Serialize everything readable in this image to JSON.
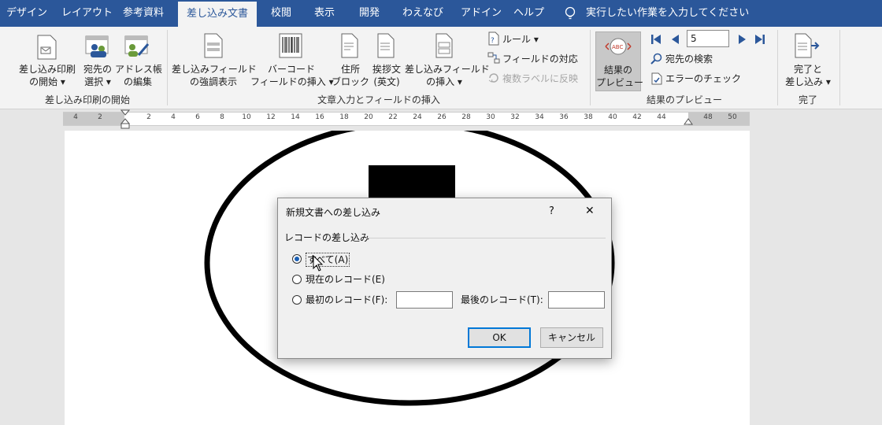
{
  "tabs": [
    "デザイン",
    "レイアウト",
    "参考資料",
    "差し込み文書",
    "校閲",
    "表示",
    "開発",
    "わえなび",
    "アドイン",
    "ヘルプ"
  ],
  "tell_me": "実行したい作業を入力してください",
  "ribbon": {
    "start_merge": {
      "label1": "差し込み印刷",
      "label2": "の開始"
    },
    "select_recipients": {
      "label1": "宛先の",
      "label2": "選択"
    },
    "edit_list": {
      "label1": "アドレス帳",
      "label2": "の編集"
    },
    "group1": "差し込み印刷の開始",
    "highlight": {
      "label1": "差し込みフィールド",
      "label2": "の強調表示"
    },
    "barcode": {
      "label1": "バーコード",
      "label2": "フィールドの挿入"
    },
    "address_block": {
      "label1": "住所",
      "label2": "ブロック"
    },
    "greeting": {
      "label1": "挨拶文",
      "label2": "(英文)"
    },
    "insert_field": {
      "label1": "差し込みフィールド",
      "label2": "の挿入"
    },
    "rules": "ルール",
    "match_fields": "フィールドの対応",
    "update_labels": "複数ラベルに反映",
    "group2": "文章入力とフィールドの挿入",
    "preview": {
      "label1": "結果の",
      "label2": "プレビュー"
    },
    "record_number": "5",
    "find_recipient": "宛先の検索",
    "check_errors": "エラーのチェック",
    "group3": "結果のプレビュー",
    "finish": {
      "label1": "完了と",
      "label2": "差し込み"
    },
    "group4": "完了"
  },
  "ruler_numbers": [
    "4",
    "2",
    "2",
    "4",
    "6",
    "8",
    "10",
    "12",
    "14",
    "16",
    "18",
    "20",
    "22",
    "24",
    "26",
    "28",
    "30",
    "32",
    "34",
    "36",
    "38",
    "40",
    "42",
    "44",
    "48",
    "50"
  ],
  "dialog": {
    "title": "新規文書への差し込み",
    "help": "?",
    "close": "✕",
    "section": "レコードの差し込み",
    "opt_all": "すべて(A)",
    "opt_current": "現在のレコード(E)",
    "opt_first": "最初のレコード(F):",
    "last_label": "最後のレコード(T):",
    "first_value": "",
    "last_value": "",
    "ok": "OK",
    "cancel": "キャンセル"
  },
  "colors": {
    "accent": "#2b579a",
    "ribbon": "#f3f3f3",
    "dialog": "#f0f0f0"
  }
}
